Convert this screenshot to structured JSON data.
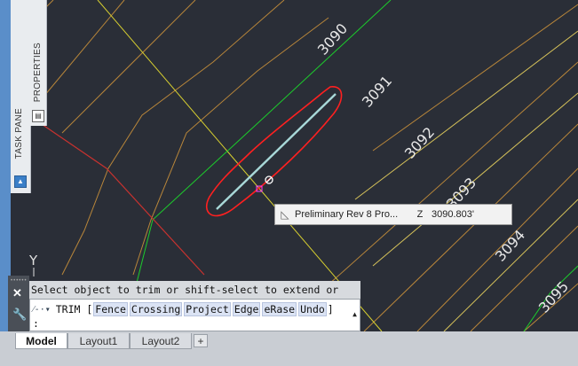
{
  "viewport": {
    "contour_labels": [
      "3090",
      "3091",
      "3092",
      "3093",
      "3094",
      "3095"
    ],
    "ucs_label": "Y"
  },
  "palettes": {
    "task_pane_label": "TASK PANE",
    "properties_label": "PROPERTIES"
  },
  "tooltip": {
    "name": "Preliminary Rev 8 Pro...",
    "key": "Z",
    "value": "3090.803'"
  },
  "command_line": {
    "history": "Select object to trim or shift-select to extend or",
    "command": "TRIM [",
    "options": [
      "Fence",
      "Crossing",
      "Project",
      "Edge",
      "eRase",
      "Undo"
    ],
    "close_bracket": "]",
    "prompt": ":"
  },
  "tabs": [
    {
      "label": "Model",
      "active": true
    },
    {
      "label": "Layout1",
      "active": false
    },
    {
      "label": "Layout2",
      "active": false
    }
  ],
  "tab_add_label": "+",
  "colors": {
    "background": "#2a2e37",
    "contour_major": "#c8b04a",
    "contour_green": "#19c02a",
    "boundary_red": "#c8322f",
    "selection_red": "#ff2020"
  }
}
